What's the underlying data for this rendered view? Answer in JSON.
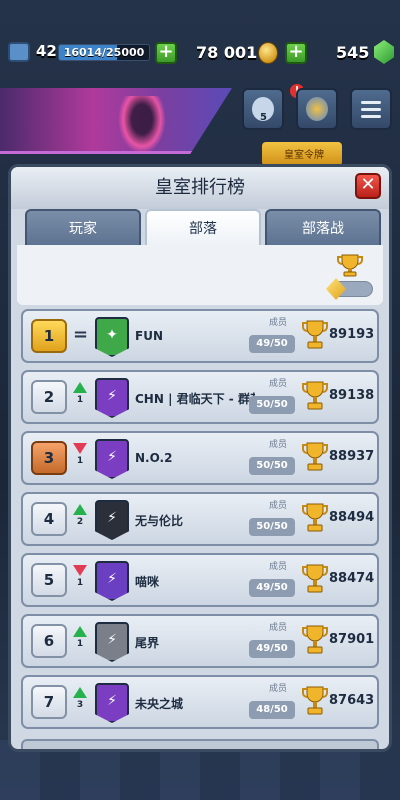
{
  "resources": {
    "level": "42",
    "xp": "16014/25000",
    "xp_progress": 0.64,
    "gold": "78 001",
    "gems": "545",
    "plus_symbol": "+"
  },
  "side": {
    "friends_count": "5",
    "notification_count": "!"
  },
  "panel": {
    "title": "皇室排行榜",
    "close_symbol": "✕",
    "tabs": [
      {
        "label": "玩家",
        "active": false
      },
      {
        "label": "部落",
        "active": true
      },
      {
        "label": "部落战",
        "active": false
      }
    ],
    "peek_label": "皇室令牌"
  },
  "rows": [
    {
      "rank": "1",
      "movement": "same",
      "change": "=",
      "name": "FUN",
      "members_label": "成员",
      "members": "49/50",
      "trophies": "89193",
      "badge_color": "#3fa848"
    },
    {
      "rank": "2",
      "movement": "up",
      "change": "1",
      "name": "CHN | 君临天下 - 群英汇",
      "members_label": "成员",
      "members": "50/50",
      "trophies": "89138",
      "badge_color": "#7b3ec2"
    },
    {
      "rank": "3",
      "movement": "down",
      "change": "1",
      "name": "N.O.2",
      "members_label": "成员",
      "members": "50/50",
      "trophies": "88937",
      "badge_color": "#7b3ec2"
    },
    {
      "rank": "4",
      "movement": "up",
      "change": "2",
      "name": "无与伦比",
      "members_label": "成员",
      "members": "50/50",
      "trophies": "88494",
      "badge_color": "#2a2f3a"
    },
    {
      "rank": "5",
      "movement": "down",
      "change": "1",
      "name": "喵咪",
      "members_label": "成员",
      "members": "49/50",
      "trophies": "88474",
      "badge_color": "#6a3fc2"
    },
    {
      "rank": "6",
      "movement": "up",
      "change": "1",
      "name": "尾界",
      "members_label": "成员",
      "members": "49/50",
      "trophies": "87901",
      "badge_color": "#7a7f8a"
    },
    {
      "rank": "7",
      "movement": "up",
      "change": "3",
      "name": "未央之城",
      "members_label": "成员",
      "members": "48/50",
      "trophies": "87643",
      "badge_color": "#7b3ec2"
    }
  ]
}
